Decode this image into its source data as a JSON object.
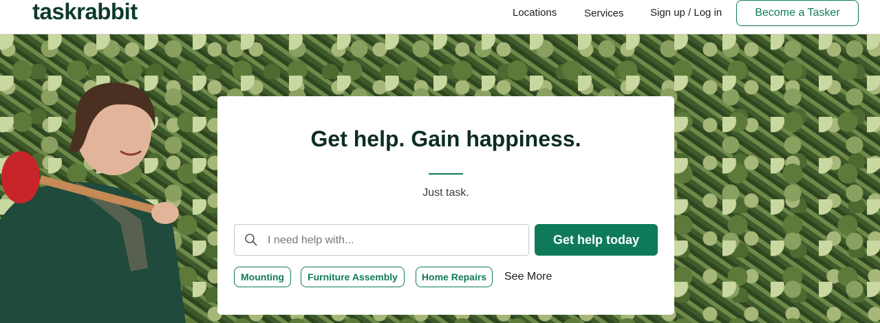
{
  "header": {
    "logo": "taskrabbit",
    "nav": {
      "locations": "Locations",
      "services": "Services",
      "signup_login": "Sign up / Log in",
      "become_tasker": "Become a Tasker"
    }
  },
  "hero": {
    "title": "Get help. Gain happiness.",
    "subtitle": "Just task.",
    "search": {
      "placeholder": "I need help with...",
      "value": ""
    },
    "cta_label": "Get help today",
    "chips": [
      "Mounting",
      "Furniture Assembly",
      "Home Repairs"
    ],
    "see_more": "See More"
  },
  "colors": {
    "brand_green": "#0f7a5a",
    "logo_dark": "#0d3b2b",
    "plunger_red": "#c8252b"
  },
  "icons": {
    "search": "search-icon"
  }
}
